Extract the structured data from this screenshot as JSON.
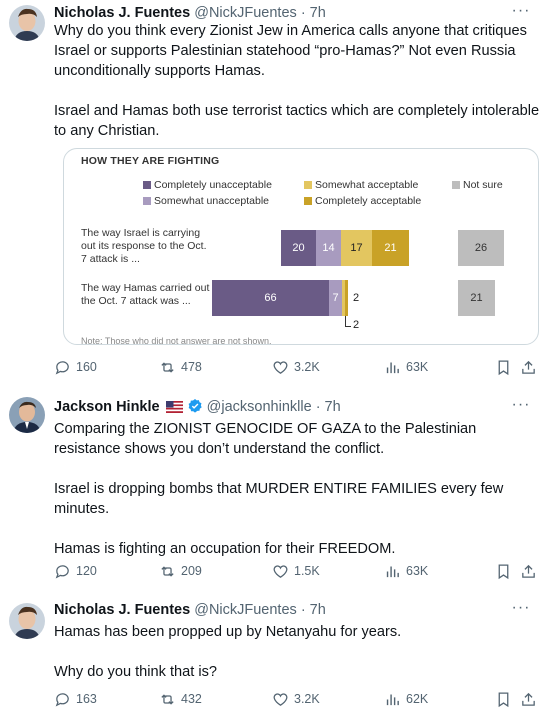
{
  "tweets": [
    {
      "name": "Nicholas J. Fuentes",
      "handle": "@NickJFuentes",
      "time": "· 7h",
      "paragraphs": [
        "Why do you think every Zionist Jew in America calls anyone that critiques Israel or supports Palestinian statehood “pro-Hamas?” Not even Russia unconditionally supports Hamas.",
        "Israel and Hamas both use terrorist tactics which are completely intolerable to any Christian."
      ],
      "stats": {
        "replies": "160",
        "reposts": "478",
        "likes": "3.2K",
        "views": "63K"
      }
    },
    {
      "name": "Jackson Hinkle",
      "handle": "@jacksonhinklle",
      "time": "· 7h",
      "paragraphs": [
        "Comparing the ZIONIST GENOCIDE OF GAZA to the Palestinian resistance shows you don’t understand the conflict.",
        "Israel is dropping bombs that MURDER ENTIRE FAMILIES every few minutes.",
        "Hamas is fighting an occupation for their FREEDOM."
      ],
      "stats": {
        "replies": "120",
        "reposts": "209",
        "likes": "1.5K",
        "views": "63K"
      }
    },
    {
      "name": "Nicholas J. Fuentes",
      "handle": "@NickJFuentes",
      "time": "· 7h",
      "paragraphs": [
        "Hamas has been propped up by Netanyahu for years.",
        "Why do you think that is?"
      ],
      "stats": {
        "replies": "163",
        "reposts": "432",
        "likes": "3.2K",
        "views": "62K"
      }
    }
  ],
  "chart": {
    "title": "HOW THEY ARE FIGHTING",
    "note": "Note: Those who did not answer are not shown.",
    "legend": [
      {
        "label": "Completely unacceptable",
        "color": "#6a5b86"
      },
      {
        "label": "Somewhat acceptable",
        "color": "#e3c660"
      },
      {
        "label": "Not sure",
        "color": "#bdbdbd"
      },
      {
        "label": "Somewhat unacceptable",
        "color": "#a89bbf"
      },
      {
        "label": "Completely acceptable",
        "color": "#c9a227"
      }
    ],
    "rows": [
      {
        "label": "The way Israel is carrying out its response to the Oct. 7 attack is ...",
        "values": {
          "completely_unacceptable": 20,
          "somewhat_unacceptable": 14,
          "somewhat_acceptable": 17,
          "completely_acceptable": 21,
          "not_sure": 26
        },
        "labels": [
          "20",
          "14",
          "17",
          "21",
          "26"
        ]
      },
      {
        "label": "The way Hamas carried out the Oct. 7 attack was ...",
        "values": {
          "completely_unacceptable": 66,
          "somewhat_unacceptable": 7,
          "somewhat_acceptable": 2,
          "completely_acceptable": 2,
          "not_sure": 21
        },
        "labels": [
          "66",
          "7",
          "2",
          "2",
          "21"
        ]
      }
    ]
  },
  "chart_data": {
    "type": "bar",
    "title": "HOW THEY ARE FIGHTING",
    "categories": [
      "The way Israel is carrying out its response to the Oct. 7 attack is ...",
      "The way Hamas carried out the Oct. 7 attack was ..."
    ],
    "series": [
      {
        "name": "Completely unacceptable",
        "values": [
          20,
          66
        ]
      },
      {
        "name": "Somewhat unacceptable",
        "values": [
          14,
          7
        ]
      },
      {
        "name": "Somewhat acceptable",
        "values": [
          17,
          2
        ]
      },
      {
        "name": "Completely acceptable",
        "values": [
          21,
          2
        ]
      },
      {
        "name": "Not sure",
        "values": [
          26,
          21
        ]
      }
    ],
    "legend": "top"
  }
}
